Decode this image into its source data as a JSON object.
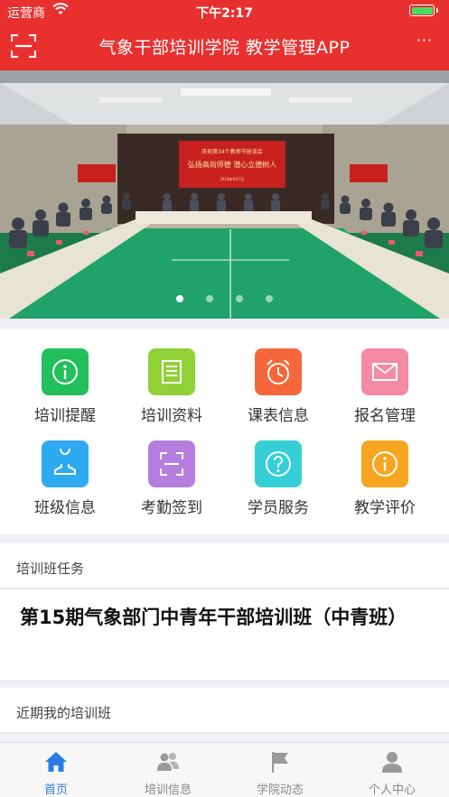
{
  "status_bar": {
    "carrier": "运营商",
    "time": "下午2:17"
  },
  "header": {
    "title": "气象干部培训学院 教学管理APP",
    "more_label": "···"
  },
  "banner": {
    "backdrop_line1": "庆祝第34个教师节座谈会",
    "backdrop_line2": "弘扬高尚师德 潜心立德树人",
    "backdrop_line3": "2018年9月7日",
    "side_screen_text": "弘扬高尚师德 潜心立德树人",
    "slide_count": 4,
    "active_slide": 0
  },
  "menu": [
    {
      "label": "培训提醒",
      "icon": "info-icon",
      "color": "#21c05b"
    },
    {
      "label": "培训资料",
      "icon": "document-icon",
      "color": "#8fd137"
    },
    {
      "label": "课表信息",
      "icon": "alarm-clock-icon",
      "color": "#f5673a"
    },
    {
      "label": "报名管理",
      "icon": "envelope-icon",
      "color": "#f48aa4"
    },
    {
      "label": "班级信息",
      "icon": "person-icon",
      "color": "#2eaaf0"
    },
    {
      "label": "考勤签到",
      "icon": "scan-frame-icon",
      "color": "#b77ee0"
    },
    {
      "label": "学员服务",
      "icon": "question-icon",
      "color": "#36cfd6"
    },
    {
      "label": "教学评价",
      "icon": "info-icon",
      "color": "#f7a51e"
    }
  ],
  "sections": {
    "task_title": "培训班任务",
    "task_name": "第15期气象部门中青年干部培训班（中青班）",
    "recent_title": "近期我的培训班"
  },
  "tabbar": [
    {
      "label": "首页",
      "icon": "home-icon",
      "active": true
    },
    {
      "label": "培训信息",
      "icon": "people-icon",
      "active": false
    },
    {
      "label": "学院动态",
      "icon": "flag-icon",
      "active": false
    },
    {
      "label": "个人中心",
      "icon": "user-icon",
      "active": false
    }
  ],
  "colors": {
    "brand_red": "#e8312f",
    "tab_active": "#2a7de1",
    "tab_inactive": "#888888"
  }
}
